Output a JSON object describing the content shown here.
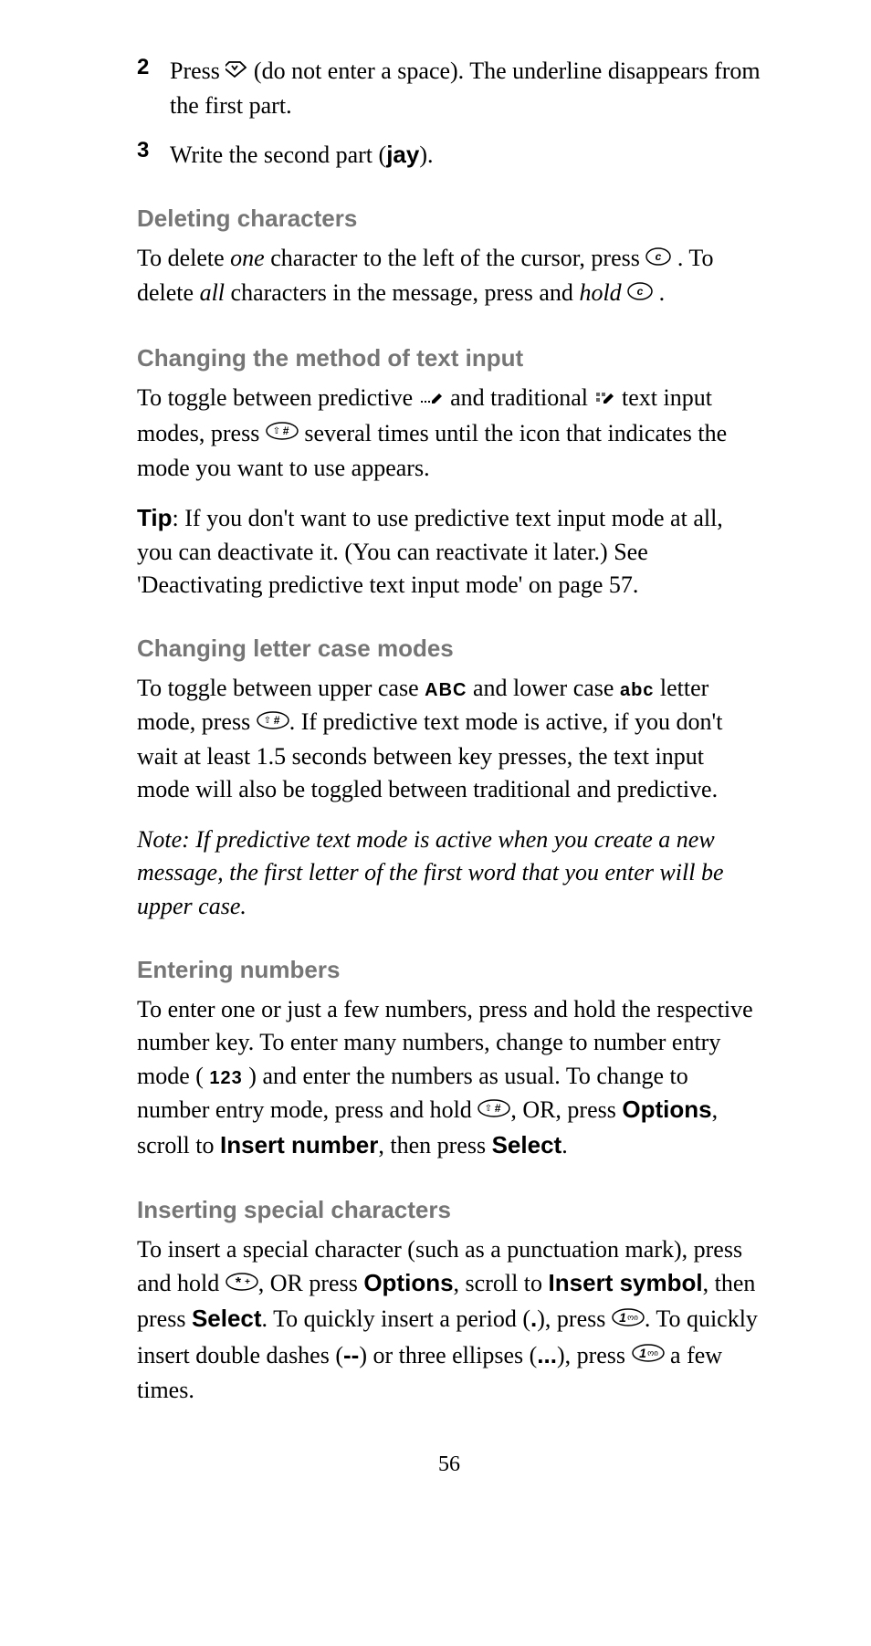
{
  "list": {
    "item2": {
      "num": "2",
      "pre": "Press ",
      "post": " (do not enter a space). The underline disappears from the first part."
    },
    "item3": {
      "num": "3",
      "text_pre": "Write the second part (",
      "text_bold": "jay",
      "text_post": ")."
    }
  },
  "section_deleting": {
    "header": "Deleting characters",
    "line1_a": "To delete ",
    "line1_i": "one",
    "line1_b": " character to the left of the cursor, press ",
    "line1_c": " . To delete ",
    "line1_i2": "all",
    "line1_d": " characters in the message, press and ",
    "line1_i3": "hold",
    "line1_e": " ",
    "line1_f": " ."
  },
  "section_method": {
    "header": "Changing the method of text input",
    "p1_a": "To toggle between predictive ",
    "p1_b": " and traditional ",
    "p1_c": " text input modes, press ",
    "p1_d": " several times until the icon that indicates the mode you want to use appears.",
    "p2_a": "Tip",
    "p2_b": ": If you don't want to use predictive text input mode at all, you can deactivate it. (You can reactivate it later.) See 'Deactivating predictive text input mode' on page 57."
  },
  "section_case": {
    "header": "Changing letter case modes",
    "p1_a": "To toggle between upper case  ",
    "p1_abc_upper": "ABC",
    "p1_b": "  and lower case  ",
    "p1_abc_lower": "abc",
    "p1_c": "  letter mode, press ",
    "p1_d": ". If predictive text mode is active, if you don't wait at least 1.5 seconds between key presses, the text input mode will also be toggled between traditional and predictive.",
    "note": "Note: If predictive text mode is active when you create a new message, the first letter of the first word that you enter will be upper case."
  },
  "section_numbers": {
    "header": "Entering numbers",
    "p1_a": "To enter one or just a few numbers, press and hold the respective number key. To enter many numbers, change to number entry mode ( ",
    "p1_123": "123",
    "p1_b": " ) and enter the numbers as usual. To change to number entry mode, press and hold ",
    "p1_c": ", OR, press ",
    "p1_opt": "Options",
    "p1_d": ", scroll to ",
    "p1_ins": "Insert number",
    "p1_e": ", then press ",
    "p1_sel": "Select",
    "p1_f": "."
  },
  "section_special": {
    "header": "Inserting special characters",
    "p1_a": "To insert a special character (such as a punctuation mark), press and hold ",
    "p1_b": ", OR press ",
    "p1_opt": "Options",
    "p1_c": ", scroll to ",
    "p1_ins": "Insert symbol",
    "p1_d": ", then press ",
    "p1_sel": "Select",
    "p1_e": ". To quickly insert a period (",
    "p1_period": ".",
    "p1_f": "), press  ",
    "p1_g": ". To quickly insert double dashes (",
    "p1_dashes": "--",
    "p1_h": ") or three ellipses (",
    "p1_ellips": "...",
    "p1_i": "), press  ",
    "p1_j": " a few times."
  },
  "page_number": "56"
}
